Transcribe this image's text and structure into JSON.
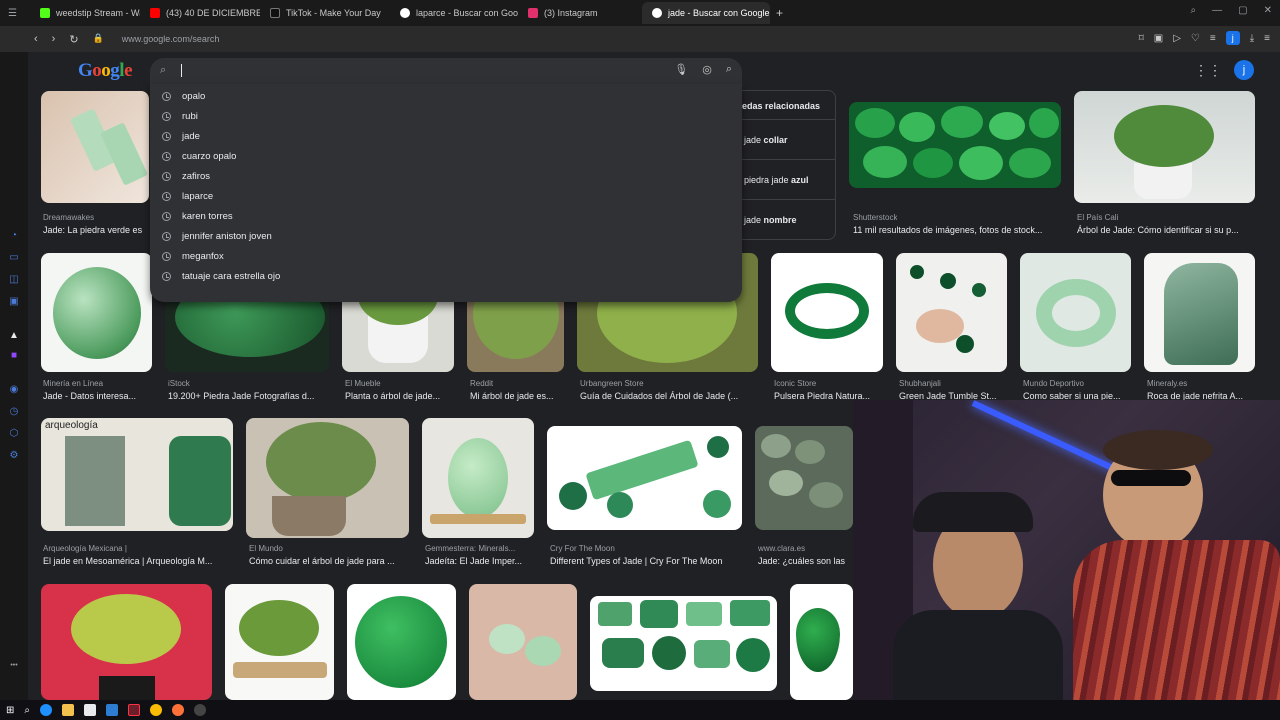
{
  "tabs": [
    {
      "label": "weedstip Stream - Watch",
      "color": "#53fc18"
    },
    {
      "label": "(43) 40 DE DICIEMBRE |",
      "color": "#ff0000"
    },
    {
      "label": "TikTok - Make Your Day",
      "color": "#ffffff"
    },
    {
      "label": "laparce - Buscar con Goo",
      "color": "#ffffff"
    },
    {
      "label": "(3) Instagram",
      "color": "#e1306c"
    },
    {
      "label": "jade - Buscar con Google",
      "color": "#ffffff"
    }
  ],
  "address": {
    "url": "www.google.com/search"
  },
  "profile": {
    "initial": "j"
  },
  "logo": {
    "letters": [
      "G",
      "o",
      "o",
      "g",
      "l",
      "e"
    ],
    "colors": [
      "#4285f4",
      "#ea4335",
      "#fbbc05",
      "#4285f4",
      "#34a853",
      "#ea4335"
    ]
  },
  "search": {
    "value": ""
  },
  "suggestions": [
    "opalo",
    "rubi",
    "jade",
    "cuarzo opalo",
    "zafiros",
    "laparce",
    "karen torres",
    "jennifer aniston joven",
    "meganfox",
    "tatuaje cara estrella ojo"
  ],
  "related": {
    "title": "edas relacionadas",
    "items": [
      {
        "prefix": "jade ",
        "bold": "collar"
      },
      {
        "prefix": "piedra jade ",
        "bold": "azul"
      },
      {
        "prefix": "jade ",
        "bold": "nombre"
      }
    ]
  },
  "results_row1": [
    {
      "source": "Dreamawakes",
      "caption": "Jade: La piedra verde es"
    },
    {
      "source": "Shutterstock",
      "caption": "11 mil resultados de imágenes, fotos de stock..."
    },
    {
      "source": "El País Cali",
      "caption": "Árbol de Jade: Cómo identificar si su p..."
    }
  ],
  "results_row2": [
    {
      "source": "Minería en Línea",
      "caption": "Jade - Datos interesa..."
    },
    {
      "source": "iStock",
      "caption": "19.200+ Piedra Jade Fotografías d..."
    },
    {
      "source": "El Mueble",
      "caption": "Planta o árbol de jade..."
    },
    {
      "source": "Reddit",
      "caption": "Mi árbol de jade es..."
    },
    {
      "source": "Urbangreen Store",
      "caption": "Guía de Cuidados del Árbol de Jade (..."
    },
    {
      "source": "Iconic Store",
      "caption": "Pulsera Piedra Natura..."
    },
    {
      "source": "Shubhanjali",
      "caption": "Green Jade Tumble St..."
    },
    {
      "source": "Mundo Deportivo",
      "caption": "Como saber si una pie..."
    },
    {
      "source": "Mineraly.es",
      "caption": "Roca de jade nefrita A..."
    }
  ],
  "results_row3": [
    {
      "source": "Arqueología Mexicana |",
      "caption": "El jade en Mesoamérica | Arqueología M..."
    },
    {
      "source": "El Mundo",
      "caption": "Cómo cuidar el árbol de jade para ..."
    },
    {
      "source": "Gemmesterra: Minerals...",
      "caption": "Jadeíta: El Jade Imper..."
    },
    {
      "source": "Cry For The Moon",
      "caption": "Different Types of Jade | Cry For The Moon"
    },
    {
      "source": "www.clara.es",
      "caption": "Jade: ¿cuáles son las"
    }
  ],
  "magazine_text": "arqueología",
  "colors": {
    "jade_dark": "#0f6b34",
    "jade_mid": "#2e9e56",
    "jade_light": "#9fd8a8",
    "accent_blue": "#1a73e8"
  }
}
